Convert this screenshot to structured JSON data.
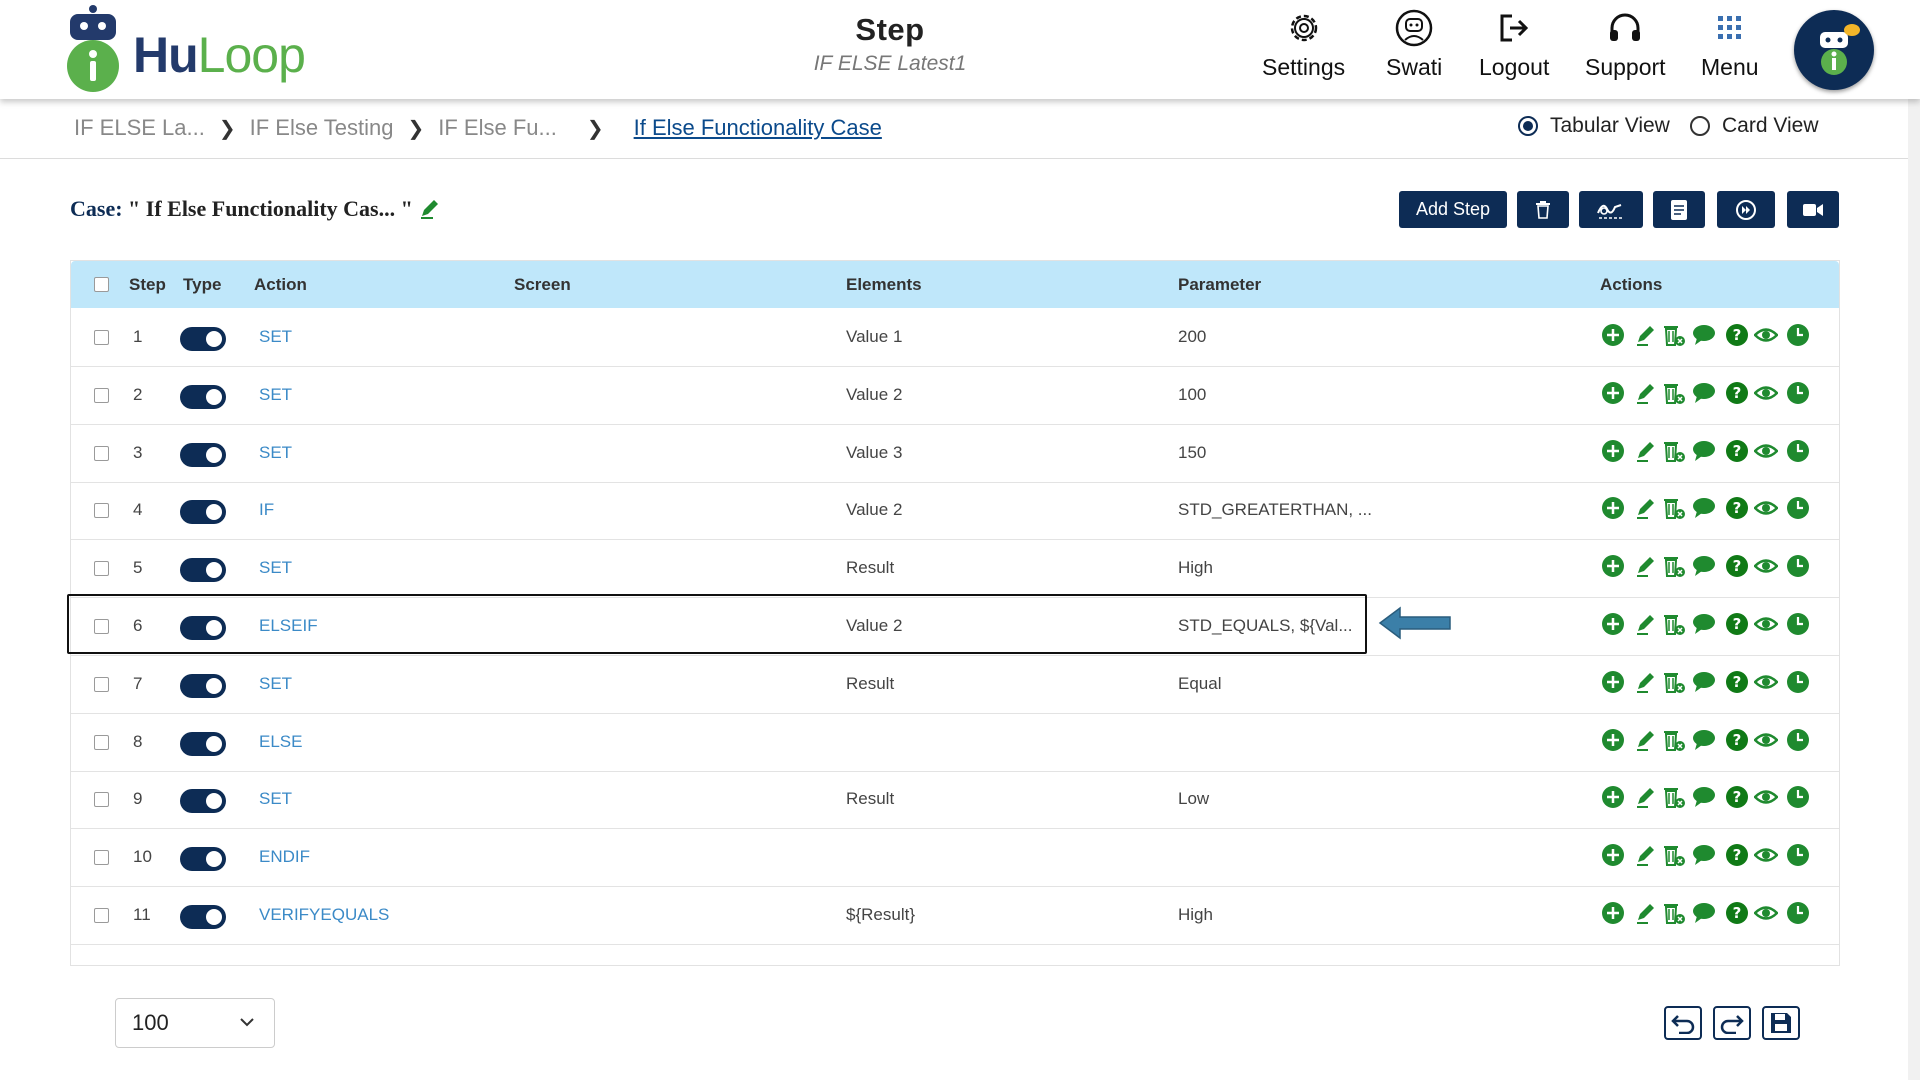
{
  "header": {
    "logo": {
      "prefix": "Hu",
      "suffix": "Loop"
    },
    "title": "Step",
    "subtitle": "IF ELSE Latest1",
    "nav": [
      {
        "label": "Settings",
        "icon": "gear-icon"
      },
      {
        "label": "Swati",
        "icon": "user-icon"
      },
      {
        "label": "Logout",
        "icon": "logout-icon"
      },
      {
        "label": "Support",
        "icon": "headset-icon"
      },
      {
        "label": "Menu",
        "icon": "grid-icon"
      }
    ]
  },
  "breadcrumb": {
    "items": [
      "IF ELSE La...",
      "IF Else Testing",
      "IF Else Fu...",
      "If Else Functionality Case"
    ],
    "views": [
      {
        "label": "Tabular View",
        "selected": true
      },
      {
        "label": "Card View",
        "selected": false
      }
    ]
  },
  "case": {
    "label": "Case:",
    "name": "\" If Else Functionality Cas... \""
  },
  "toolbar": {
    "add_step_label": "Add Step",
    "icons": [
      "trash-icon",
      "signature-icon",
      "document-icon",
      "play-forward-icon",
      "video-icon"
    ]
  },
  "table": {
    "headers": [
      "Step",
      "Type",
      "Action",
      "Screen",
      "Elements",
      "Parameter",
      "Actions"
    ],
    "rows": [
      {
        "step": "1",
        "enabled": true,
        "action": "SET",
        "screen": "",
        "elements": "Value 1",
        "parameter": "200"
      },
      {
        "step": "2",
        "enabled": true,
        "action": "SET",
        "screen": "",
        "elements": "Value 2",
        "parameter": "100"
      },
      {
        "step": "3",
        "enabled": true,
        "action": "SET",
        "screen": "",
        "elements": "Value 3",
        "parameter": "150"
      },
      {
        "step": "4",
        "enabled": true,
        "action": "IF",
        "screen": "",
        "elements": "Value 2",
        "parameter": "STD_GREATERTHAN, ..."
      },
      {
        "step": "5",
        "enabled": true,
        "action": "SET",
        "screen": "",
        "elements": "Result",
        "parameter": "High"
      },
      {
        "step": "6",
        "enabled": true,
        "action": "ELSEIF",
        "screen": "",
        "elements": "Value 2",
        "parameter": "STD_EQUALS, ${Val..."
      },
      {
        "step": "7",
        "enabled": true,
        "action": "SET",
        "screen": "",
        "elements": "Result",
        "parameter": "Equal"
      },
      {
        "step": "8",
        "enabled": true,
        "action": "ELSE",
        "screen": "",
        "elements": "",
        "parameter": ""
      },
      {
        "step": "9",
        "enabled": true,
        "action": "SET",
        "screen": "",
        "elements": "Result",
        "parameter": "Low"
      },
      {
        "step": "10",
        "enabled": true,
        "action": "ENDIF",
        "screen": "",
        "elements": "",
        "parameter": ""
      },
      {
        "step": "11",
        "enabled": true,
        "action": "VERIFYEQUALS",
        "screen": "",
        "elements": "${Result}",
        "parameter": "High"
      }
    ],
    "row_actions": [
      "add-icon",
      "edit-icon",
      "delete-icon",
      "comment-icon",
      "help-icon",
      "view-icon",
      "clock-icon"
    ],
    "highlighted_step": "6"
  },
  "footer": {
    "page_size": "100",
    "icons": [
      "undo-icon",
      "redo-icon",
      "save-icon"
    ]
  },
  "colors": {
    "primary": "#0d2c55",
    "header_row": "#bfe7fa",
    "action_link": "#3b8ac7",
    "icon_green": "#1f8a2f",
    "logo_green": "#5bb04c",
    "arrow": "#3b7fa8"
  }
}
